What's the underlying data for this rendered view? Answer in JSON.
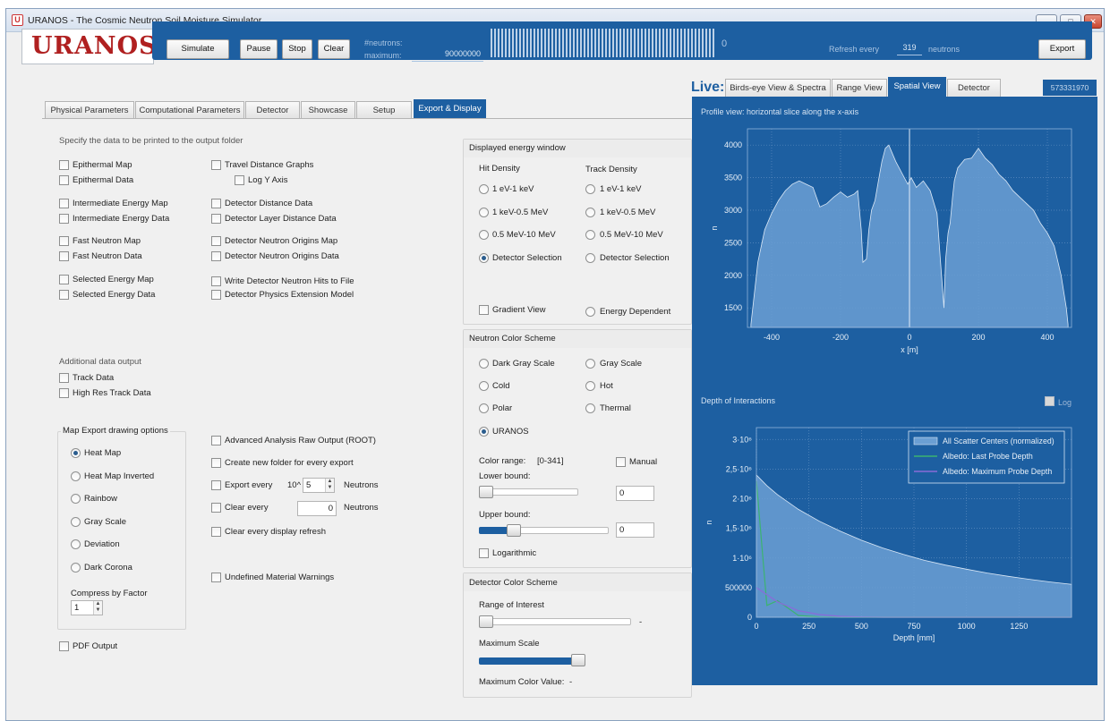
{
  "window": {
    "title": "URANOS - The Cosmic Neutron Soil Moisture Simulator",
    "minimize": "—",
    "maximize": "□",
    "close": "✕"
  },
  "logo": "URANOS",
  "toolbar": {
    "simulate": "Simulate",
    "pause": "Pause",
    "stop": "Stop",
    "clear": "Clear",
    "neutrons_label": "#neutrons:",
    "maximum_label": "maximum:",
    "maximum_value": "90000000",
    "progress_value": "0",
    "refresh_label": "Refresh every",
    "refresh_value": "319",
    "refresh_unit": "neutrons",
    "export": "Export"
  },
  "tabs": [
    "Physical Parameters",
    "Computational Parameters",
    "Detector",
    "Showcase",
    "Setup",
    "Export & Display"
  ],
  "active_tab": "Export & Display",
  "export": {
    "heading": "Specify the data to be printed to the output folder",
    "col1": [
      "Epithermal Map",
      "Epithermal Data",
      "Intermediate Energy Map",
      "Intermediate Energy Data",
      "Fast Neutron Map",
      "Fast Neutron Data",
      "Selected Energy Map",
      "Selected Energy Data"
    ],
    "col2": [
      "Travel Distance Graphs",
      "Log Y Axis",
      "Detector Distance Data",
      "Detector Layer Distance Data",
      "Detector Neutron Origins Map",
      "Detector Neutron Origins Data",
      "Write Detector Neutron Hits to File",
      "Detector Physics Extension Model"
    ],
    "additional_heading": "Additional data output",
    "additional": [
      "Track Data",
      "High Res Track Data"
    ],
    "map_export_title": "Map Export drawing options",
    "map_export_options": [
      "Heat Map",
      "Heat Map Inverted",
      "Rainbow",
      "Gray Scale",
      "Deviation",
      "Dark Corona"
    ],
    "map_export_selected": "Heat Map",
    "compress_label": "Compress by Factor",
    "compress_value": "1",
    "pdf_output": "PDF Output",
    "advanced_raw": "Advanced Analysis Raw Output (ROOT)",
    "new_folder": "Create new folder for every export",
    "export_every": "Export every",
    "export_every_prefix": "10^",
    "export_every_value": "5",
    "export_every_unit": "Neutrons",
    "clear_every": "Clear every",
    "clear_every_value": "0",
    "clear_every_unit": "Neutrons",
    "clear_every_refresh": "Clear every display refresh",
    "undefined_warnings": "Undefined Material Warnings"
  },
  "energy_window": {
    "title": "Displayed energy window",
    "hit_density": "Hit Density",
    "track_density": "Track Density",
    "options": [
      "1 eV-1 keV",
      "1 keV-0.5 MeV",
      "0.5 MeV-10 MeV",
      "Detector Selection"
    ],
    "hit_selected": "Detector Selection",
    "gradient_view": "Gradient View",
    "energy_dependent": "Energy Dependent"
  },
  "neutron_color": {
    "title": "Neutron Color Scheme",
    "col1": [
      "Dark Gray Scale",
      "Cold",
      "Polar",
      "URANOS"
    ],
    "col2": [
      "Gray Scale",
      "Hot",
      "Thermal"
    ],
    "selected": "URANOS",
    "color_range_label": "Color range:",
    "color_range_value": "[0-341]",
    "manual": "Manual",
    "lower_label": "Lower bound:",
    "lower_value": "0",
    "upper_label": "Upper bound:",
    "upper_value": "0",
    "logarithmic": "Logarithmic"
  },
  "detector_color": {
    "title": "Detector Color Scheme",
    "range_label": "Range of Interest",
    "range_dash": "-",
    "max_scale_label": "Maximum Scale",
    "max_color_label": "Maximum Color Value:",
    "max_color_value": "-"
  },
  "live": {
    "label": "Live:",
    "tabs": [
      "Birds-eye View & Spectra",
      "Range View",
      "Spatial View",
      "Detector"
    ],
    "active_tab": "Spatial View",
    "counter": "573331970",
    "profile_title": "Profile view: horizontal slice along the x-axis",
    "depth_title": "Depth of Interactions",
    "log_label": "Log"
  },
  "colors": {
    "accent": "#1d5fa1",
    "fill": "#6b9fd3",
    "albedo_last": "#3cb371",
    "albedo_max": "#8a6bd8"
  },
  "chart_data": [
    {
      "type": "area",
      "xlabel": "x [m]",
      "ylabel": "n",
      "xlim": [
        -470,
        470
      ],
      "ylim": [
        1200,
        4250
      ],
      "xticks": [
        -400,
        -200,
        0,
        200,
        400
      ],
      "yticks": [
        1500,
        2000,
        2500,
        3000,
        3500,
        4000
      ],
      "grid": true,
      "x": [
        -460,
        -440,
        -420,
        -400,
        -380,
        -360,
        -340,
        -320,
        -300,
        -280,
        -260,
        -240,
        -220,
        -200,
        -180,
        -160,
        -150,
        -140,
        -135,
        -125,
        -118,
        -110,
        -100,
        -90,
        -80,
        -70,
        -60,
        -40,
        -20,
        -5,
        0,
        5,
        20,
        40,
        60,
        80,
        90,
        100,
        105,
        112,
        118,
        125,
        130,
        140,
        160,
        180,
        200,
        220,
        240,
        260,
        280,
        300,
        320,
        340,
        360,
        380,
        400,
        420,
        440,
        455,
        460
      ],
      "values": [
        1250,
        2200,
        2700,
        2950,
        3150,
        3300,
        3400,
        3450,
        3400,
        3350,
        3050,
        3100,
        3200,
        3280,
        3200,
        3250,
        3300,
        2700,
        2200,
        2250,
        2700,
        3000,
        3150,
        3450,
        3750,
        3950,
        4000,
        3750,
        3550,
        3400,
        3450,
        3500,
        3350,
        3450,
        3300,
        2950,
        2200,
        1500,
        2250,
        2650,
        2800,
        3200,
        3450,
        3650,
        3780,
        3800,
        3950,
        3800,
        3700,
        3550,
        3450,
        3300,
        3200,
        3100,
        3000,
        2800,
        2650,
        2450,
        2000,
        1500,
        1250
      ]
    },
    {
      "type": "line",
      "xlabel": "Depth [mm]",
      "ylabel": "n",
      "xlim": [
        0,
        1500
      ],
      "ylim": [
        0,
        3200000
      ],
      "xticks": [
        0,
        250,
        500,
        750,
        1000,
        1250
      ],
      "ytick_labels": [
        "0",
        "500000",
        "1·10⁶",
        "1,5·10⁶",
        "2·10⁶",
        "2,5·10⁶",
        "3·10⁶"
      ],
      "grid": true,
      "legend": "top-right",
      "x": [
        0,
        50,
        100,
        200,
        300,
        400,
        500,
        600,
        700,
        800,
        900,
        1000,
        1100,
        1200,
        1300,
        1400,
        1500
      ],
      "series": [
        {
          "name": "All Scatter Centers (normalized)",
          "values": [
            2400000,
            2220000,
            2070000,
            1820000,
            1620000,
            1450000,
            1300000,
            1170000,
            1060000,
            960000,
            880000,
            810000,
            745000,
            690000,
            640000,
            595000,
            555000
          ]
        },
        {
          "name": "Albedo: Last Probe Depth",
          "values": [
            2300000,
            200000,
            280000,
            30000,
            5000,
            0,
            0,
            0,
            0,
            0,
            0,
            0,
            0,
            0,
            0,
            0,
            0
          ]
        },
        {
          "name": "Albedo: Maximum Probe Depth",
          "values": [
            500000,
            380000,
            260000,
            110000,
            45000,
            15000,
            5000,
            0,
            0,
            0,
            0,
            0,
            0,
            0,
            0,
            0,
            0
          ]
        }
      ]
    }
  ]
}
